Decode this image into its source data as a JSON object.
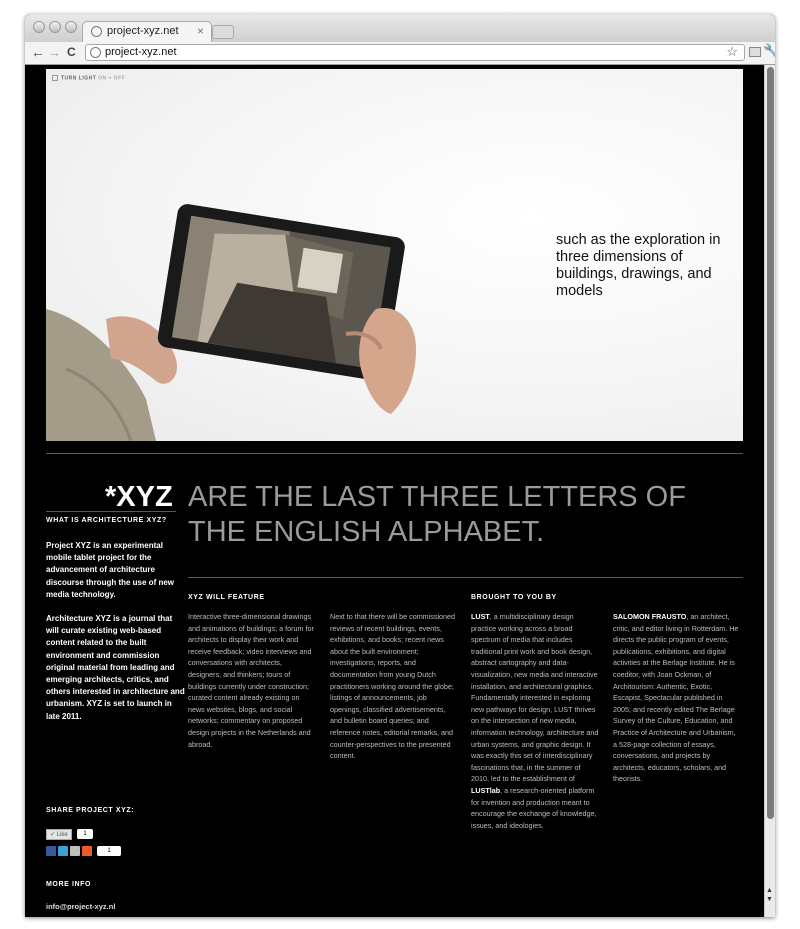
{
  "browser": {
    "tab_title": "project-xyz.net",
    "tab_close": "×",
    "url": "project-xyz.net",
    "back": "←",
    "forward": "→",
    "reload": "C",
    "star": "☆",
    "wrench": "🔧"
  },
  "hero": {
    "toggle_prefix": "TURN LIGHT ",
    "toggle_on": "ON",
    "toggle_sep": " – ",
    "toggle_off": "OFF",
    "caption": "such as the exploration in three dimensions of buildings, drawings, and models"
  },
  "headline": {
    "xyz": "*XYZ",
    "text": "ARE THE LAST THREE LETTERS OF THE ENGLISH ALPHABET."
  },
  "sidebar": {
    "what_heading": "WHAT IS ARCHITECTURE XYZ?",
    "what_p1": "Project XYZ is an experimental mobile tablet project for the advancement of architecture discourse through the use of new media technology.",
    "what_p2": "Architecture XYZ is a journal that will curate existing web-based content related to the built environment and commission original material from leading and emerging architects, critics, and others interested in architecture and urbanism. XYZ is set to launch in late 2011.",
    "share_heading": "SHARE PROJECT XYZ:",
    "like_label": "Like",
    "like_count": "1",
    "share_count": "1",
    "more_heading": "MORE INFO",
    "email": "info@project-xyz.nl"
  },
  "features": {
    "heading": "XYZ WILL FEATURE",
    "col1": "Interactive three-dimensional drawings and animations of buildings; a forum for architects to display their work and receive feedback; video interviews and conversations with architects, designers, and thinkers; tours of buildings currently under construction; curated content already existing on news websites, blogs, and social networks; commentary on proposed design projects in the Netherlands and abroad.",
    "col2": "Next to that there will be commissioned reviews of recent buildings, events, exhibitions, and books; recent news about the built environment; investigations, reports, and documentation from young Dutch practitioners working around the globe; listings of announcements, job openings, classified advertisements, and bulletin board queries; and reference notes, editorial remarks, and counter-perspectives to the presented content."
  },
  "credits": {
    "heading": "BROUGHT TO YOU BY",
    "lust_name": "LUST",
    "lust_text": ", a multidisciplinary design practice working across a broad spectrum of media that includes traditional print work and book design, abstract cartography and data-visualization, new media and interactive installation, and architectural graphics. Fundamentally interested in exploring new pathways for design, LUST thrives on the intersection of new media, information technology, architecture and urban systems, and graphic design. It was exactly this set of interdisciplinary fascinations that, in the summer of 2010, led to the establishment of ",
    "lustlab": "LUSTlab",
    "lust_tail": ", a research-oriented platform for invention and production meant to encourage the exchange of knowledge, issues, and ideologies.",
    "salomon_name": "SALOMON FRAUSTO",
    "salomon_text": ", an architect, critic, and editor living in Rotterdam. He directs the public program of events, publications, exhibitions, and digital activities at the Berlage Institute. He is coeditor, with Joan Ockman, of Architourism: Authentic, Exotic, Escapist, Spectacular published in 2005; and recently edited The Berlage Survey of the Culture, Education, and Practice of Architecture and Urbanism, a 528-page collection of essays, conversations, and projects by architects, educators, scholars, and theorists."
  },
  "colors": {
    "background": "#000000",
    "heading_gray": "#9a9a9a",
    "body_gray": "#bdbdbd",
    "facebook": "#3b5998",
    "twitter": "#3aa0d8",
    "email": "#bfbfbf",
    "addthis": "#f05a28"
  }
}
